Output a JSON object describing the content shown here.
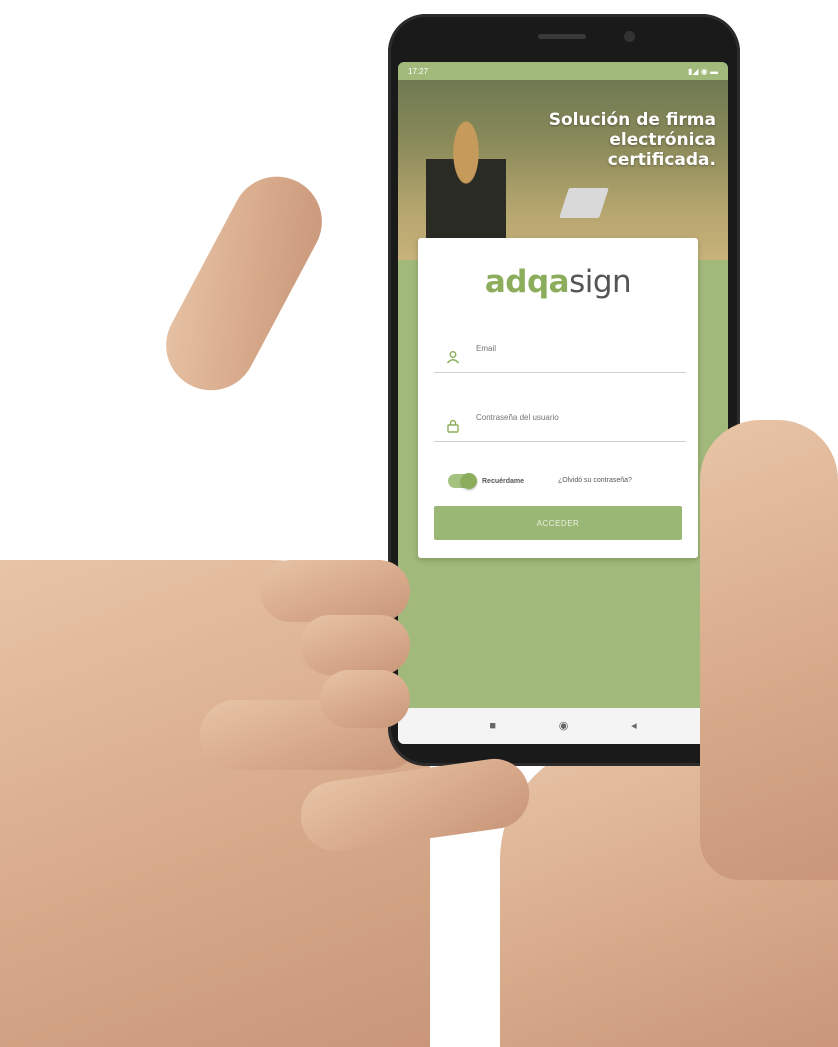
{
  "status_bar": {
    "time": "17:27",
    "indicators": "▮◢ ◉ ▬"
  },
  "hero": {
    "title": "Solución de firma electrónica certificada."
  },
  "logo": {
    "part1": "adqa",
    "part2": "sign"
  },
  "form": {
    "email_placeholder": "Email",
    "password_placeholder": "Contraseña del usuario",
    "remember_label": "Recuérdame",
    "remember_on": true,
    "forgot_link": "¿Olvidó su contraseña?",
    "submit_label": "ACCEDER"
  },
  "nav": {
    "recent_icon": "■",
    "home_icon": "◉",
    "back_icon": "◂"
  },
  "colors": {
    "brand_green": "#8cae5c",
    "background_green": "#a1b97b"
  }
}
